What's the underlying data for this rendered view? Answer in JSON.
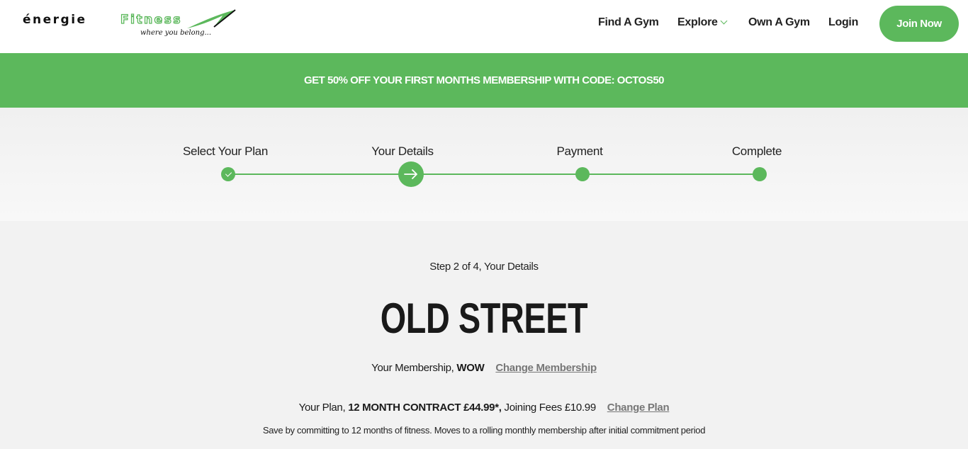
{
  "brand": {
    "name_part1": "énergie",
    "name_part2": "Fitness",
    "tagline": "where you belong...",
    "accent": "#5cb85c"
  },
  "nav": {
    "find_gym": "Find A Gym",
    "explore": "Explore",
    "own_gym": "Own A Gym",
    "login": "Login",
    "join": "Join Now"
  },
  "promo": {
    "text": "GET 50% OFF YOUR FIRST MONTHS MEMBERSHIP WITH CODE: OCTOS50"
  },
  "steps": [
    {
      "label": "Select Your Plan",
      "state": "complete",
      "icon": "check-icon"
    },
    {
      "label": "Your Details",
      "state": "current",
      "icon": "arrow-right-icon"
    },
    {
      "label": "Payment",
      "state": "upcoming"
    },
    {
      "label": "Complete",
      "state": "upcoming"
    }
  ],
  "main": {
    "step_count": "Step 2 of 4,  Your Details",
    "gym_name": "OLD STREET",
    "membership_label": "Your Membership,",
    "membership_value": "WOW",
    "change_membership": "Change Membership",
    "plan_label": "Your Plan,",
    "plan_value": "12 MONTH CONTRACT £44.99*,",
    "joining_fees": "Joining Fees £10.99",
    "change_plan": "Change Plan",
    "note": "Save by committing to 12 months of fitness. Moves to a rolling monthly membership after initial commitment period"
  }
}
